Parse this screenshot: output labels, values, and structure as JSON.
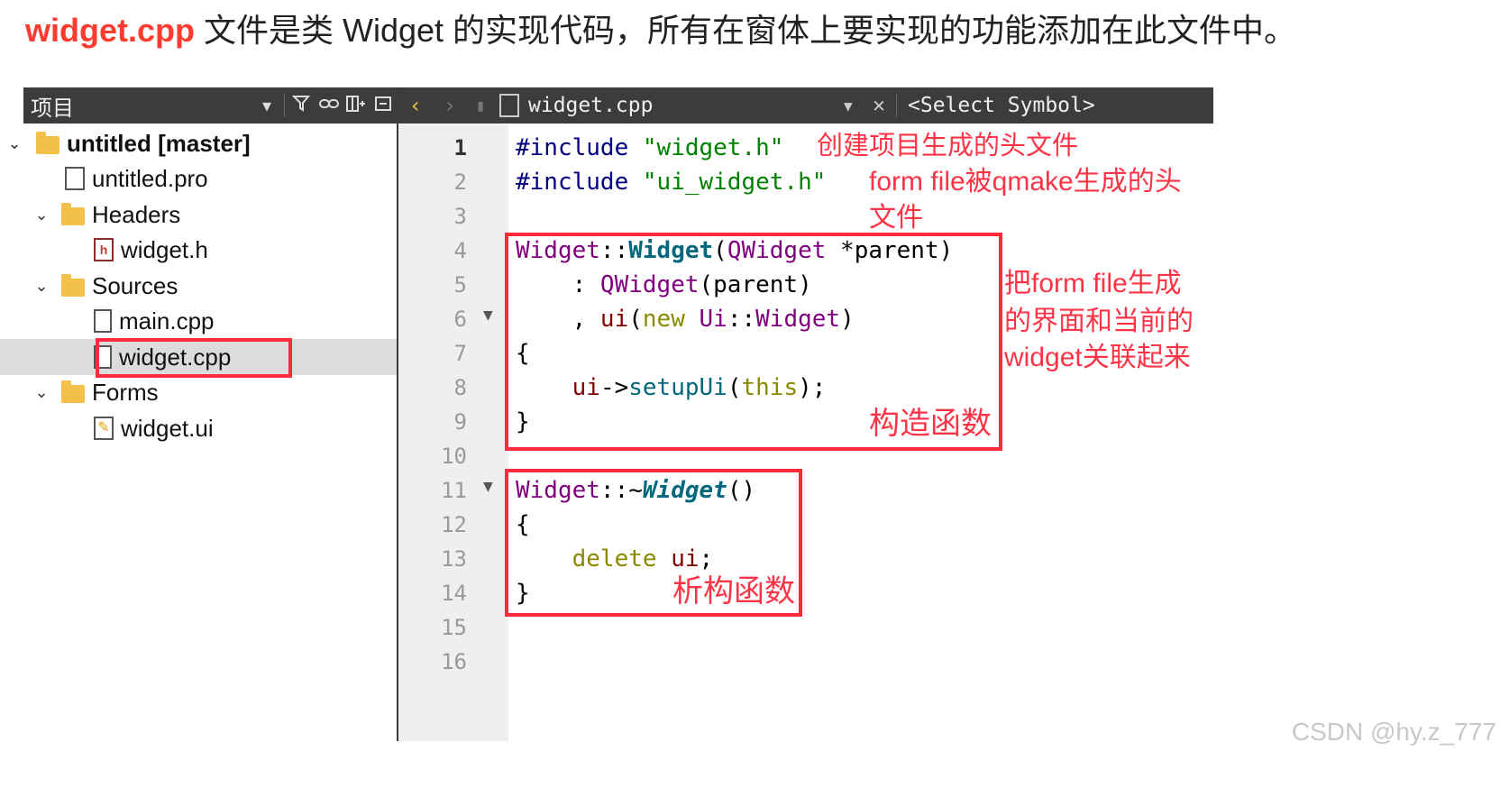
{
  "heading": {
    "filename": "widget.cpp",
    "text": " 文件是类 Widget 的实现代码，所有在窗体上要实现的功能添加在此文件中。"
  },
  "project_panel": {
    "title": "项目",
    "tree": [
      {
        "label": "untitled [master]",
        "icon": "qt-project-folder-icon",
        "expanded": true
      },
      {
        "label": "untitled.pro",
        "icon": "pro-file-icon"
      },
      {
        "label": "Headers",
        "icon": "headers-folder-icon",
        "expanded": true
      },
      {
        "label": "widget.h",
        "icon": "header-file-icon"
      },
      {
        "label": "Sources",
        "icon": "sources-folder-icon",
        "expanded": true
      },
      {
        "label": "main.cpp",
        "icon": "cpp-file-icon"
      },
      {
        "label": "widget.cpp",
        "icon": "cpp-file-icon",
        "selected": true
      },
      {
        "label": "Forms",
        "icon": "forms-folder-icon",
        "expanded": true
      },
      {
        "label": "widget.ui",
        "icon": "ui-file-icon"
      }
    ]
  },
  "editor": {
    "file_name": "widget.cpp",
    "symbol_placeholder": "<Select Symbol>",
    "line_numbers": [
      "1",
      "2",
      "3",
      "4",
      "5",
      "6",
      "7",
      "8",
      "9",
      "10",
      "11",
      "12",
      "13",
      "14",
      "15",
      "16"
    ],
    "code": {
      "l1_kw": "#include",
      "l1_str": "\"widget.h\"",
      "l2_kw": "#include",
      "l2_str": "\"ui_widget.h\"",
      "l4_a": "Widget",
      "l4_b": "::",
      "l4_c": "Widget",
      "l4_d": "(",
      "l4_e": "QWidget",
      "l4_f": " *parent)",
      "l5_a": "    : ",
      "l5_b": "QWidget",
      "l5_c": "(parent)",
      "l6_a": "    , ",
      "l6_b": "ui",
      "l6_c": "(",
      "l6_d": "new",
      "l6_e": " ",
      "l6_f": "Ui",
      "l6_g": "::",
      "l6_h": "Widget",
      "l6_i": ")",
      "l7": "{",
      "l8_a": "    ",
      "l8_b": "ui",
      "l8_c": "->",
      "l8_d": "setupUi",
      "l8_e": "(",
      "l8_f": "this",
      "l8_g": ");",
      "l9": "}",
      "l11_a": "Widget",
      "l11_b": "::~",
      "l11_c": "Widget",
      "l11_d": "()",
      "l12": "{",
      "l13_a": "    ",
      "l13_b": "delete",
      "l13_c": " ",
      "l13_d": "ui",
      "l13_e": ";",
      "l14": "}"
    }
  },
  "annotations": {
    "include_note": "创建项目生成的头文件",
    "form_note_1": "form file被qmake生成的头",
    "form_note_2": "文件",
    "link_note_1": "把form file生成",
    "link_note_2": "的界面和当前的",
    "link_note_3": "widget关联起来",
    "constructor_label": "构造函数",
    "destructor_label": "析构函数"
  },
  "watermark": "CSDN @hy.z_777",
  "colors": {
    "annotation_red": "#ff2a3a",
    "toolbar_bg": "#3c3c3c",
    "gutter_bg": "#efefef"
  }
}
